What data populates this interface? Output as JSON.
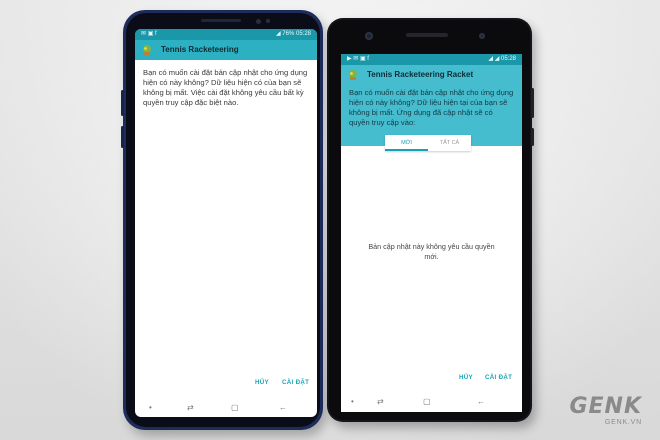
{
  "phone_left": {
    "status_bar": {
      "notification_icons": "✉ ▣ f",
      "signal": "◢ 76%",
      "time": "05:28"
    },
    "app_title": "Tennis Racketeering",
    "message": "Bạn có muốn cài đặt bản cập nhật cho ứng dụng hiện có này không? Dữ liệu hiện có của bạn sẽ không bị mất. Việc cài đặt không yêu cầu bất kỳ quyền truy cập đặc biệt nào.",
    "cancel_label": "HỦY",
    "install_label": "CÀI ĐẶT",
    "nav": {
      "dot": "•",
      "recents": "⇄",
      "home": "▢",
      "back": "←"
    }
  },
  "phone_right": {
    "status_bar": {
      "notification_icons": "▶ ✉ ▣ f",
      "signal": "◢ ◢",
      "time": "05:28"
    },
    "app_title": "Tennis Racketeering Racket",
    "message": "Bạn có muốn cài đặt bản cập nhật cho ứng dụng hiện có này không? Dữ liệu hiện tại của bạn sẽ không bị mất. Ứng dụng đã cập nhật sẽ có quyền truy cập vào:",
    "tab_new": "MỚI",
    "tab_all": "TẤT CẢ",
    "center_message": "Bản cập nhật này không yêu cầu quyền mới.",
    "cancel_label": "HỦY",
    "install_label": "CÀI ĐẶT",
    "nav": {
      "dot": "•",
      "recents": "⇄",
      "home": "▢",
      "back": "←"
    }
  },
  "watermark": {
    "logo": "GENK",
    "url": "GENK.VN"
  },
  "colors": {
    "status_bar": "#1a97a8",
    "app_bar": "#2db0c2",
    "header_right": "#46bccf",
    "accent": "#1aa3b6"
  }
}
